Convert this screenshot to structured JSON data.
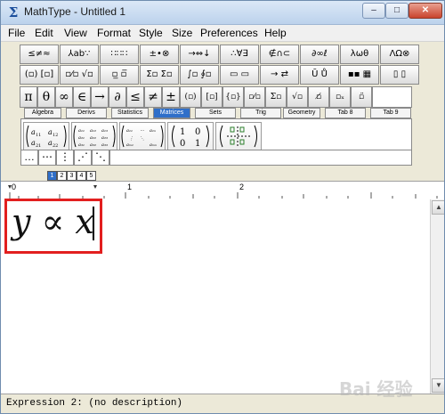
{
  "window": {
    "title": "MathType - Untitled 1",
    "controls": {
      "minimize": "–",
      "maximize": "□",
      "close": "✕"
    }
  },
  "menu": {
    "items": [
      "File",
      "Edit",
      "View",
      "Format",
      "Style",
      "Size",
      "Preferences",
      "Help"
    ]
  },
  "toolbar": {
    "row1": [
      "≤≠≈",
      "⅄ab∵",
      "∷∷∷",
      "±•⊗",
      "→⇔↓",
      "∴∀∃",
      "∉∩⊂",
      "∂∞ℓ",
      "λωθ",
      "ΛΩ⊗"
    ],
    "row2": [
      "(▫) [▫]",
      "▫⁄▫ √▫",
      "▫̲ ▫̅",
      "Σ▫ Σ▫",
      "∫▫ ∮▫",
      "▭ ▭",
      "→ ⇄",
      "Ū Ů",
      "▪▪ ▦",
      "▯ ▯"
    ],
    "row3": [
      "π",
      "θ",
      "∞",
      "∈",
      "→",
      "∂",
      "≤",
      "≠",
      "±",
      "(▫)",
      "[▫]",
      "{▫}",
      "▫⁄▫",
      "Σ▫",
      "√▫",
      "▫̸",
      "▫ₓ",
      "▫̈"
    ],
    "tabs": [
      "Algebra",
      "Derivs",
      "Statistics",
      "Matrices",
      "Sets",
      "Trig",
      "Geometry",
      "Tab 8",
      "Tab 9"
    ],
    "selected_tab": "Matrices",
    "templates": [
      "a11 a12 / a21 a22",
      "3x3 matrix",
      "dotted matrix",
      "(1 0 / 0 1)",
      "dashed matrix"
    ],
    "dot_buttons": [
      "…",
      "⋯",
      "⋮",
      "⋰",
      "⋱"
    ]
  },
  "size_selector": {
    "items": [
      "1",
      "2",
      "3",
      "4",
      "5"
    ],
    "selected": "1"
  },
  "ruler": {
    "labels": [
      "0",
      "1",
      "2"
    ]
  },
  "equation": {
    "lhs": "y",
    "operator": "∝",
    "rhs": "x"
  },
  "status": {
    "text": "Expression 2:  (no description)"
  },
  "watermark": {
    "text": "Bai 经验"
  }
}
